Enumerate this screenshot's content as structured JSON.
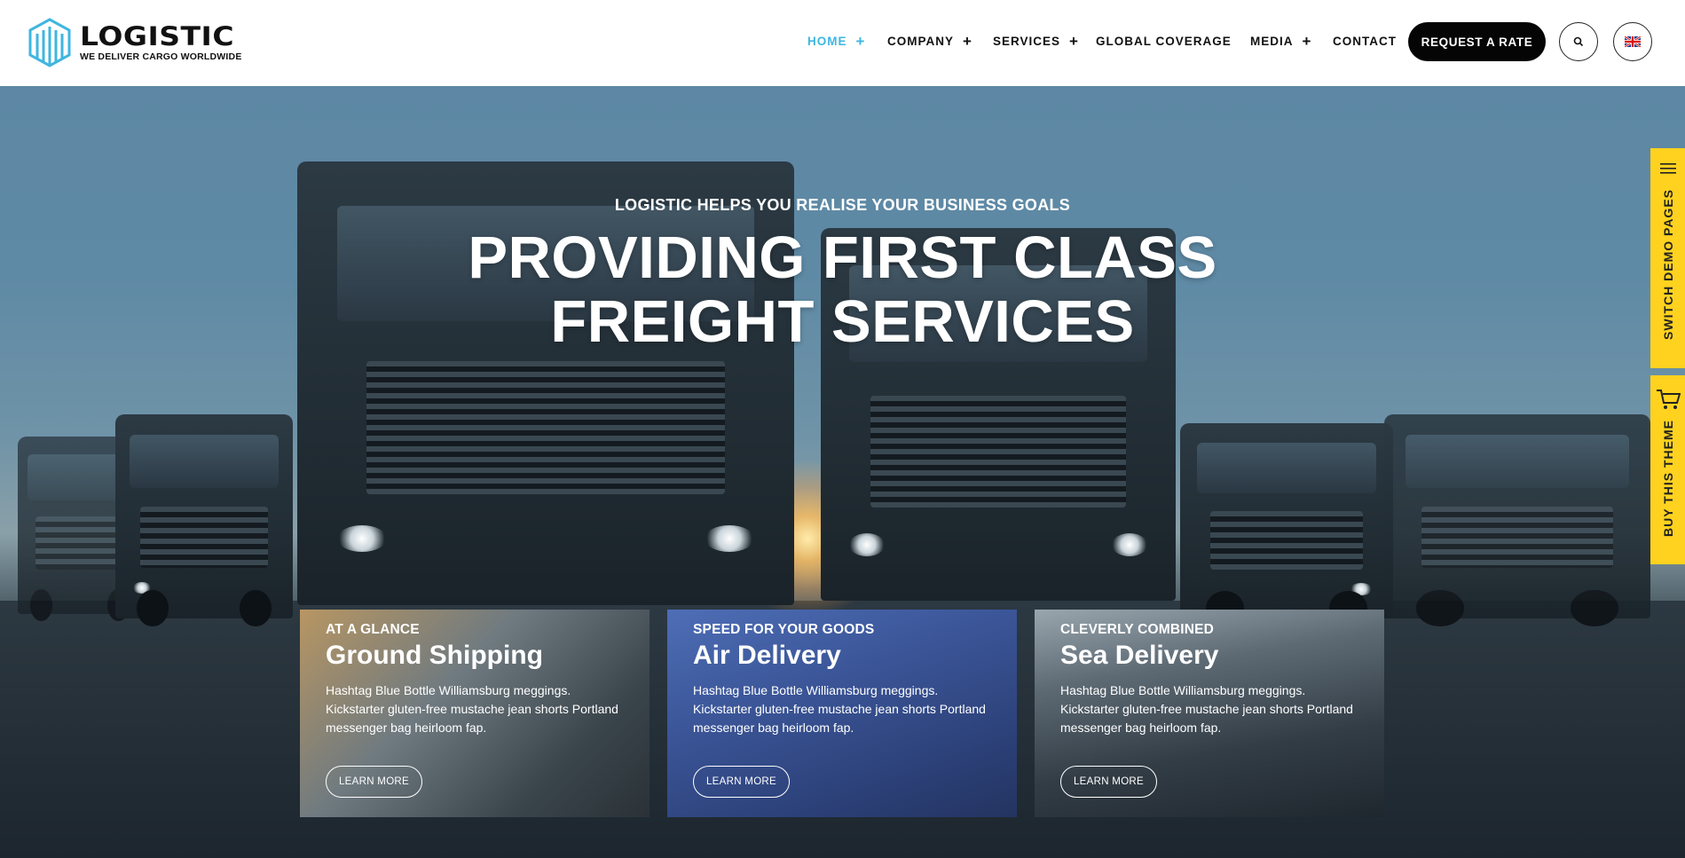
{
  "brand": {
    "name": "LOGISTIC",
    "tagline": "WE DELIVER CARGO WORLDWIDE",
    "accent_color": "#3fb6e0"
  },
  "nav": {
    "items": [
      {
        "label": "HOME",
        "has_submenu": true,
        "active": true
      },
      {
        "label": "COMPANY",
        "has_submenu": true,
        "active": false
      },
      {
        "label": "SERVICES",
        "has_submenu": true,
        "active": false
      },
      {
        "label": "GLOBAL COVERAGE",
        "has_submenu": false,
        "active": false
      },
      {
        "label": "MEDIA",
        "has_submenu": true,
        "active": false
      },
      {
        "label": "CONTACT",
        "has_submenu": false,
        "active": false
      }
    ],
    "submenu_glyph": "+",
    "cta_label": "REQUEST A RATE",
    "search_icon": "search-icon",
    "language_icon": "uk-flag-icon"
  },
  "hero": {
    "subtitle": "LOGISTIC HELPS YOU REALISE YOUR BUSINESS GOALS",
    "title_line1": "PROVIDING FIRST CLASS",
    "title_line2": "FREIGHT SERVICES"
  },
  "cards": [
    {
      "kicker": "AT A GLANCE",
      "title": "Ground Shipping",
      "text": "Hashtag Blue Bottle Williamsburg meggings. Kickstarter gluten-free mustache jean shorts Portland messenger bag heirloom fap.",
      "button": "LEARN MORE"
    },
    {
      "kicker": "SPEED FOR YOUR GOODS",
      "title": "Air Delivery",
      "text": "Hashtag Blue Bottle Williamsburg meggings. Kickstarter gluten-free mustache jean shorts Portland messenger bag heirloom fap.",
      "button": "LEARN MORE"
    },
    {
      "kicker": "CLEVERLY COMBINED",
      "title": "Sea Delivery",
      "text": "Hashtag Blue Bottle Williamsburg meggings. Kickstarter gluten-free mustache jean shorts Portland messenger bag heirloom fap.",
      "button": "LEARN MORE"
    }
  ],
  "side_tabs": {
    "demo_label": "SWITCH DEMO PAGES",
    "buy_label": "BUY THIS THEME",
    "color": "#ffd21f"
  }
}
